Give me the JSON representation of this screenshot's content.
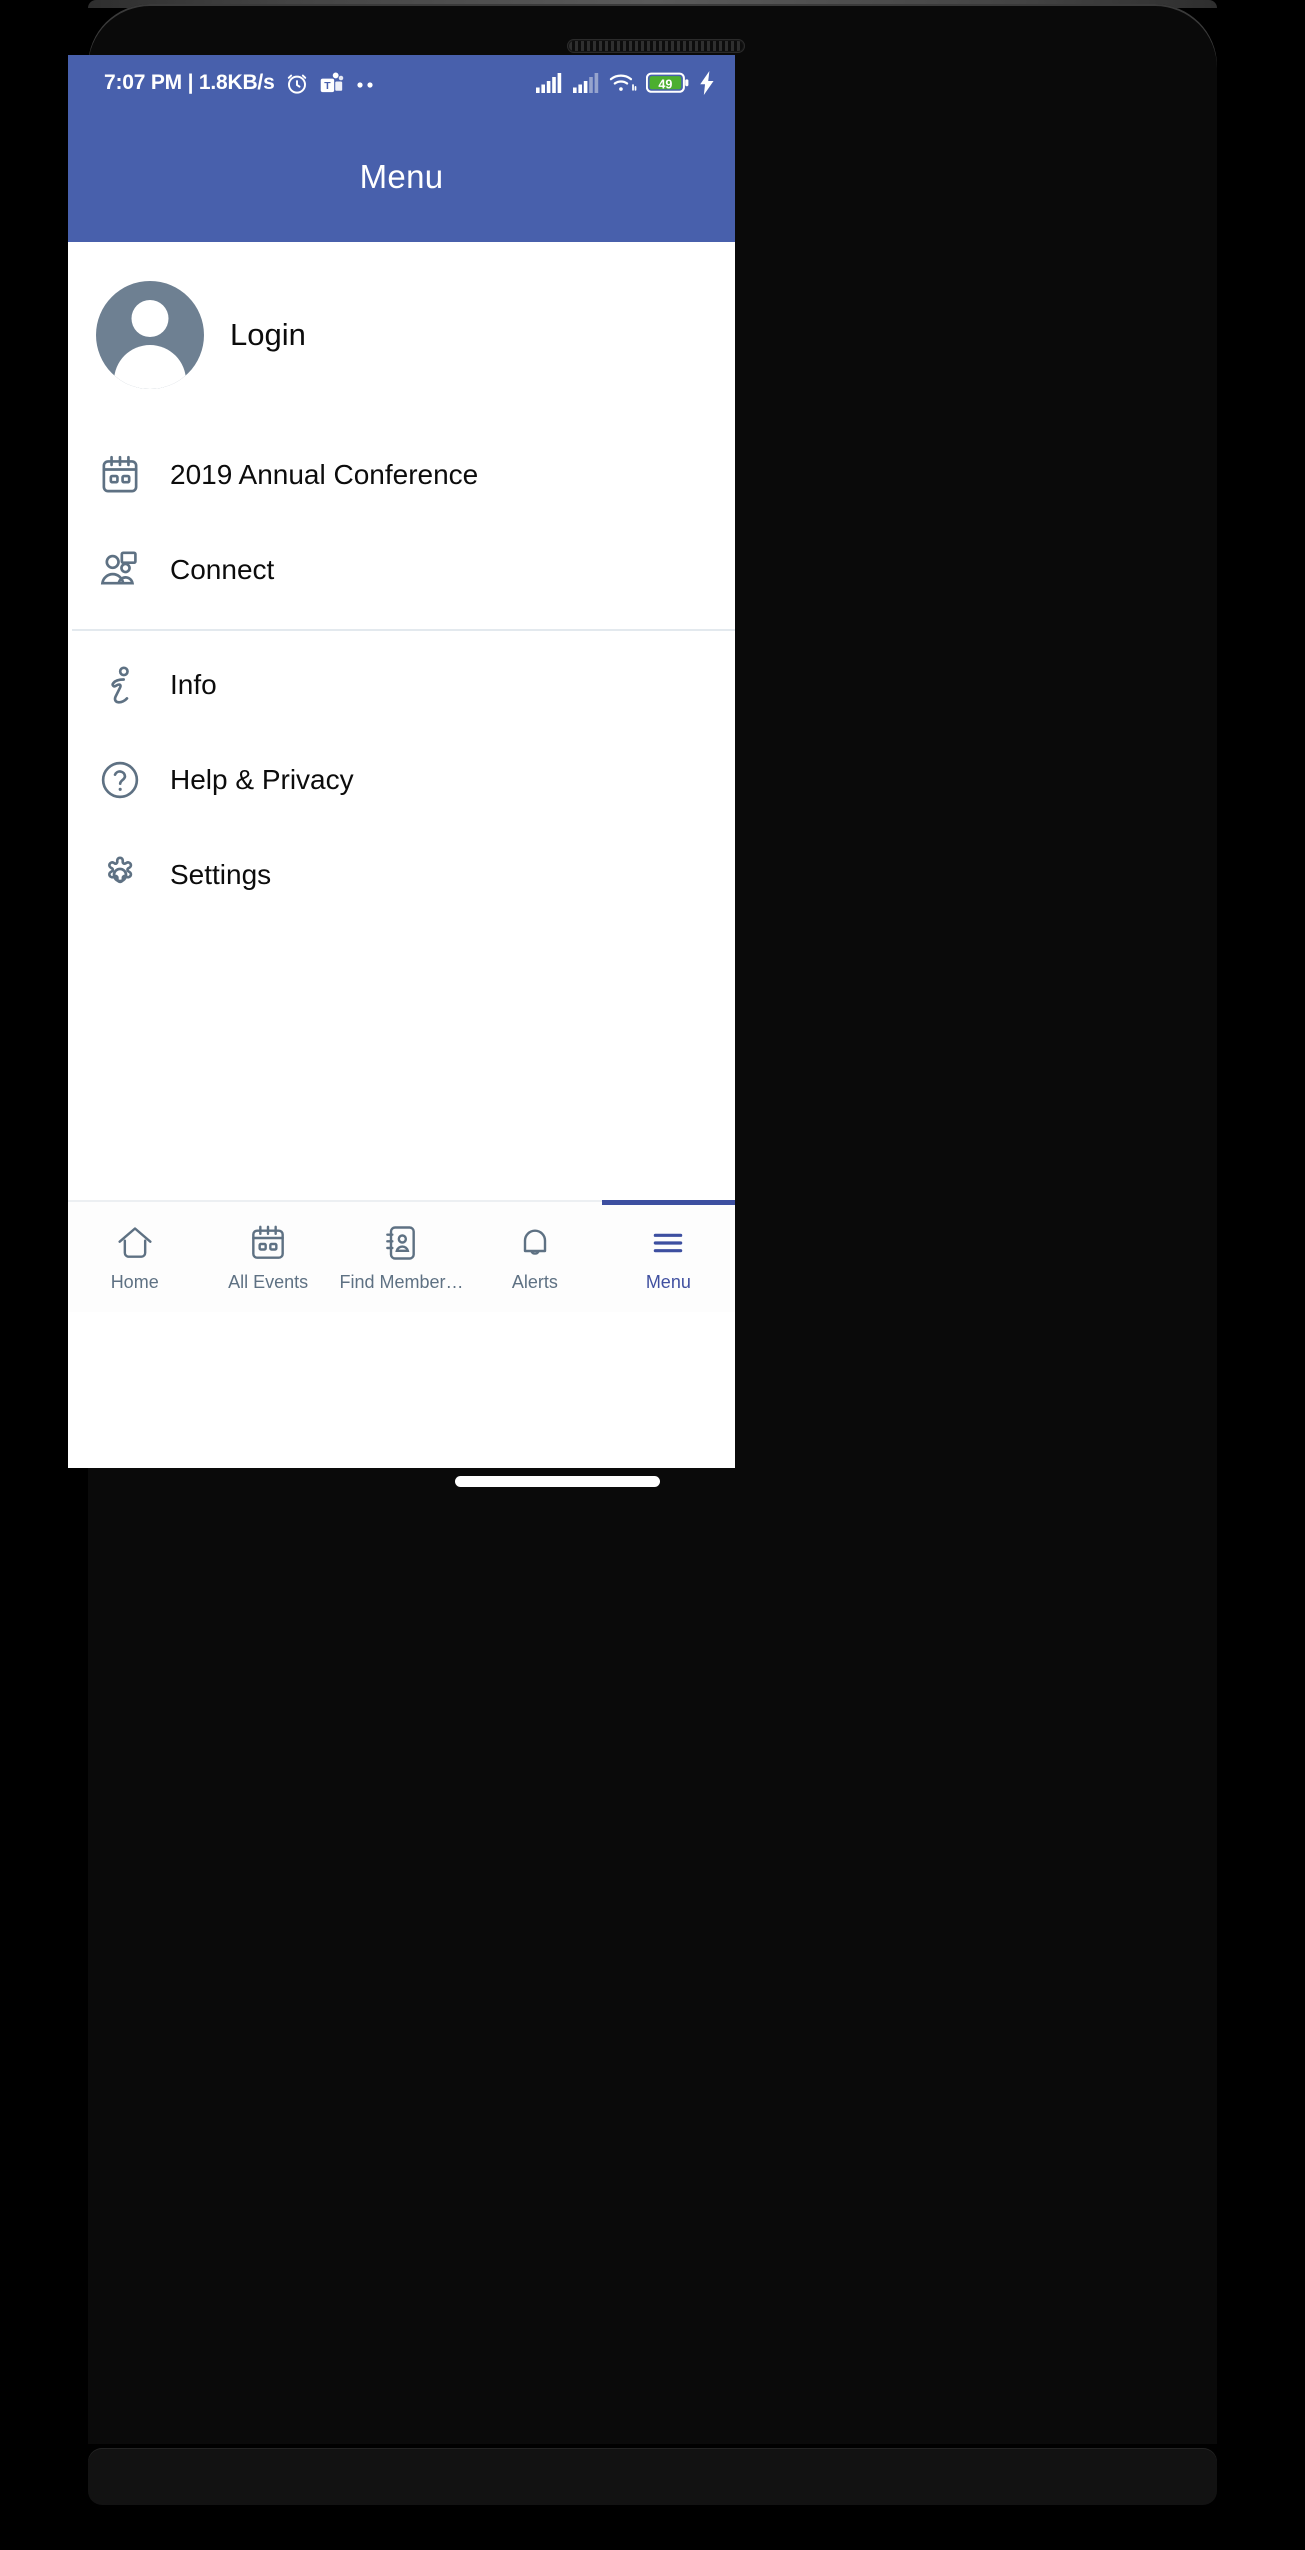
{
  "theme": {
    "brand_blue": "#4860ac",
    "nav_active_blue": "#3d4fa0",
    "icon_gray": "#5e7183",
    "avatar_gray": "#6e8092",
    "battery_green": "#4caf2f",
    "text_dark": "#0c0c0c",
    "divider": "#e3e9ee"
  },
  "status_bar": {
    "clock_and_network": "7:07 PM | 1.8KB/s",
    "icons": [
      "alarm-clock-icon",
      "microsoft-teams-icon",
      "more-dots-icon"
    ],
    "right_icons": [
      "signal-bars-sim1-icon",
      "signal-bars-sim2-icon",
      "wifi-icon",
      "battery-icon",
      "charging-bolt-icon"
    ],
    "battery_level": "49"
  },
  "app_bar": {
    "title": "Menu"
  },
  "profile": {
    "avatar_icon": "person-avatar-icon",
    "label": "Login"
  },
  "menu": {
    "groups": [
      {
        "items": [
          {
            "label": "2019 Annual Conference",
            "icon": "calendar-icon"
          },
          {
            "label": "Connect",
            "icon": "people-connect-icon"
          }
        ]
      },
      {
        "items": [
          {
            "label": "Info",
            "icon": "info-italic-i-icon"
          },
          {
            "label": "Help & Privacy",
            "icon": "question-circle-icon"
          },
          {
            "label": "Settings",
            "icon": "gear-icon"
          }
        ]
      }
    ]
  },
  "bottom_nav": {
    "items": [
      {
        "label": "Home",
        "icon": "home-icon",
        "active": false
      },
      {
        "label": "All Events",
        "icon": "calendar-icon",
        "active": false
      },
      {
        "label": "Find Member…",
        "icon": "contact-book-icon",
        "active": false
      },
      {
        "label": "Alerts",
        "icon": "bell-icon",
        "active": false
      },
      {
        "label": "Menu",
        "icon": "hamburger-menu-icon",
        "active": true
      }
    ]
  },
  "system": {
    "gesture_bar": "home-gesture-bar",
    "speaker_grille": "speaker-grille"
  }
}
